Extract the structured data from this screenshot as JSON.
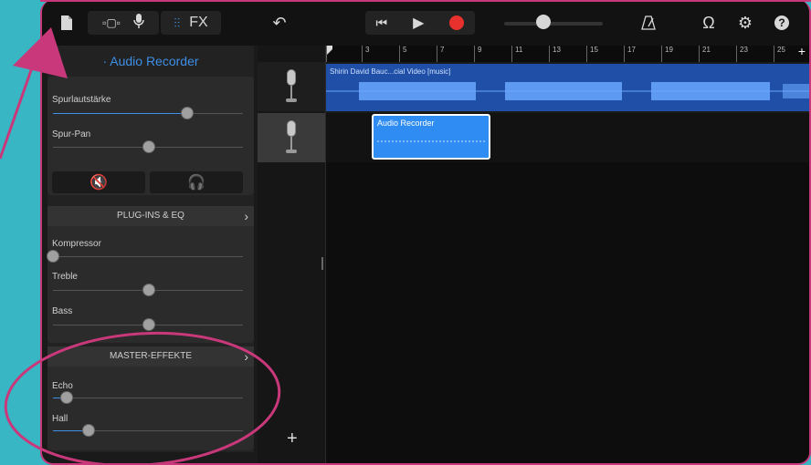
{
  "colors": {
    "background": "#38b6c4",
    "annotation": "#c8387a",
    "accent": "#3d8fe8",
    "record": "#e8302c"
  },
  "toolbar": {
    "fx_label": "FX",
    "help_label": "?",
    "icons": [
      "document-icon",
      "browser-icon",
      "mic-icon",
      "mixer-icon",
      "undo-icon",
      "skip-back-icon",
      "play-icon",
      "record-icon",
      "master-volume-slider",
      "metronome-icon",
      "loop-icon",
      "settings-icon",
      "help-icon"
    ],
    "master_volume": 0.37
  },
  "panel": {
    "title": "· Audio Recorder",
    "track_volume_label": "Spurlautstärke",
    "track_volume": 0.71,
    "track_pan_label": "Spur-Pan",
    "track_pan": 0.5,
    "plugins_header": "PLUG-INS & EQ",
    "compressor_label": "Kompressor",
    "compressor": 0.0,
    "treble_label": "Treble",
    "treble": 0.5,
    "bass_label": "Bass",
    "bass": 0.5,
    "master_header": "MASTER-EFFEKTE",
    "echo_label": "Echo",
    "echo": 0.06,
    "hall_label": "Hall",
    "hall": 0.18
  },
  "ruler": {
    "labels": [
      "3",
      "5",
      "7",
      "9",
      "11",
      "13",
      "15",
      "17",
      "19",
      "21",
      "23",
      "25"
    ],
    "add": "+"
  },
  "tracks": {
    "region1_title": "Shirin David Bauc...cial Video [music]",
    "region2_title": "Audio Recorder",
    "add_track": "+"
  }
}
